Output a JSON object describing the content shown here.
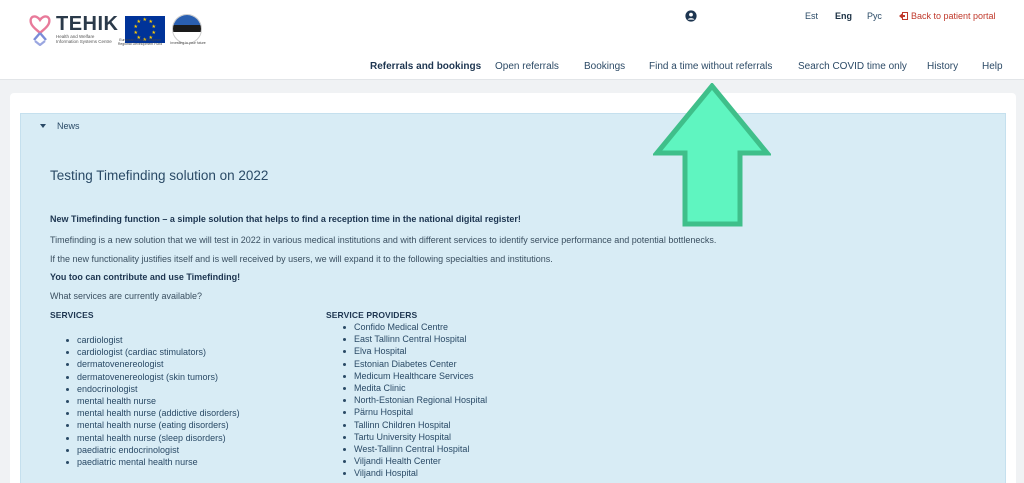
{
  "branding": {
    "name": "TEHIK",
    "subtitle": "Health and Welfare Information Systems Centre",
    "eu_caption": "European Union European Regional Development Fund",
    "est_caption": "Investing in your future"
  },
  "header": {
    "languages": [
      "Est",
      "Eng",
      "Рус"
    ],
    "active_language": "Eng",
    "back_link": "Back to patient portal"
  },
  "nav": {
    "items": [
      "Referrals and bookings",
      "Open referrals",
      "Bookings",
      "Find a time without referrals",
      "Search COVID time only",
      "History",
      "Help"
    ],
    "active": "Referrals and bookings"
  },
  "news": {
    "section_label": "News",
    "title": "Testing Timefinding solution on 2022",
    "intro_bold": "New Timefinding function – a simple solution that helps to find a reception time in the national digital register!",
    "para1": "Timefinding is a new solution that we will test in 2022 in various medical institutions and with different services to identify service performance and potential bottlenecks.",
    "para2": "If the new functionality justifies itself and is well received by users, we will expand it to the following specialties and institutions.",
    "contribute_bold": "You too can contribute and use Timefinding!",
    "question": "What services are currently available?",
    "services_heading": "SERVICES",
    "providers_heading": "SERVICE PROVIDERS",
    "services": [
      "cardiologist",
      "cardiologist (cardiac stimulators)",
      "dermatovenereologist",
      "dermatovenereologist (skin tumors)",
      "endocrinologist",
      "mental health nurse",
      "mental health nurse (addictive disorders)",
      "mental health nurse (eating disorders)",
      "mental health nurse (sleep disorders)",
      "paediatric endocrinologist",
      "paediatric mental health nurse"
    ],
    "providers": [
      "Confido Medical Centre",
      "East Tallinn Central Hospital",
      "Elva Hospital",
      "Estonian Diabetes Center",
      "Medicum Healthcare Services",
      "Medita Clinic",
      "North-Estonian Regional Hospital",
      "Pärnu Hospital",
      "Tallinn Children Hospital",
      "Tartu University Hospital",
      "West-Tallinn Central Hospital",
      "Viljandi Health Center",
      "Viljandi Hospital"
    ]
  },
  "colors": {
    "accent": "#2a4a66",
    "panel": "#d8ecf5",
    "arrow_fill": "#5ff5c0",
    "arrow_stroke": "#3fbf8a",
    "back_link": "#c0392b"
  }
}
